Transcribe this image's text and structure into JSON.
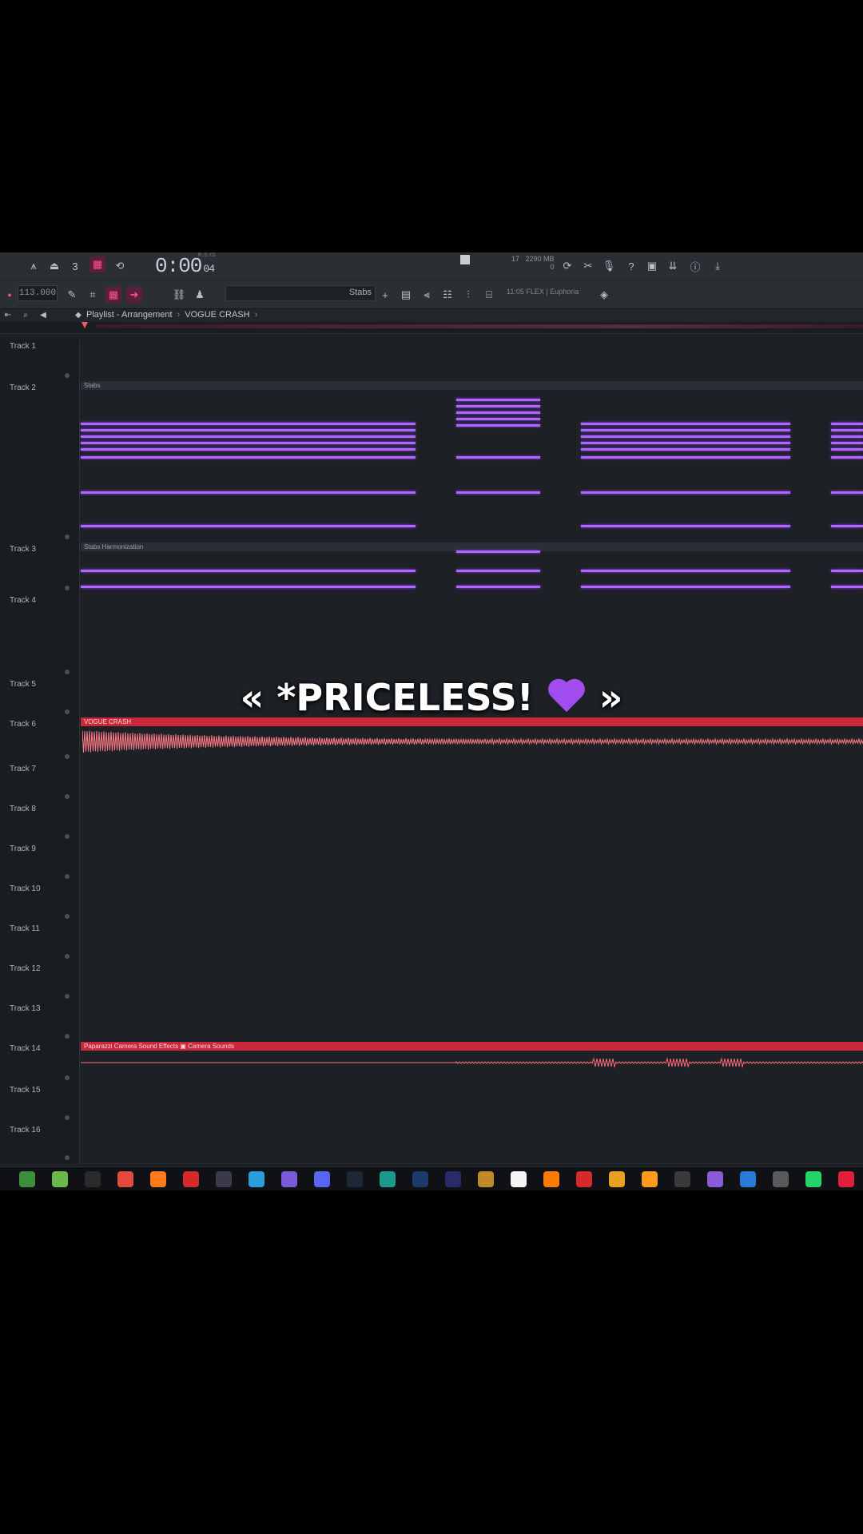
{
  "toolbar": {
    "time_main": "0:00",
    "time_sec": "04",
    "time_unit": "M:S:CS",
    "tempo": "113.000",
    "pattern_label": "Stabs",
    "cpu_value": "17",
    "memory": "2290 MB",
    "memory_sub": "0",
    "hint_text": "11:05 FLEX | Euphoria"
  },
  "header": {
    "path": "Playlist - Arrangement",
    "project": "VOGUE CRASH"
  },
  "tracks": [
    {
      "label": "Track 1"
    },
    {
      "label": "Track 2",
      "clip": "Stabs"
    },
    {
      "label": "Track 3",
      "clip": "Stabs Harmonization"
    },
    {
      "label": "Track 4"
    },
    {
      "label": "Track 5"
    },
    {
      "label": "Track 6",
      "clip": "VOGUE CRASH"
    },
    {
      "label": "Track 7"
    },
    {
      "label": "Track 8"
    },
    {
      "label": "Track 9"
    },
    {
      "label": "Track 10"
    },
    {
      "label": "Track 11"
    },
    {
      "label": "Track 12"
    },
    {
      "label": "Track 13"
    },
    {
      "label": "Track 14",
      "clip": "Paparazzi Camera Sound Effects ▣ Camera Sounds"
    },
    {
      "label": "Track 15"
    },
    {
      "label": "Track 16"
    }
  ],
  "caption": {
    "left": "« *PRICELESS!",
    "right": "»"
  },
  "colors": {
    "midi": "#b066ff",
    "audio_clip": "#c8283a",
    "accent_pink": "#ff4f8b"
  },
  "taskbar_icons": [
    "file-manager-icon",
    "app-icon",
    "chrome-icon",
    "firefox-icon",
    "red-app-icon",
    "terminal-icon",
    "sky-app-icon",
    "windows-app-icon",
    "discord-icon",
    "steam-icon",
    "globe-icon",
    "photoshop-icon",
    "after-effects-icon",
    "game-icon",
    "document-icon",
    "fl-studio-icon",
    "red-square-icon",
    "yellow-app-icon",
    "orange-app-icon",
    "folder-icon",
    "audio-icon",
    "vscode-icon",
    "misc-icon",
    "whatsapp-icon",
    "record-icon",
    "extra-icon"
  ]
}
